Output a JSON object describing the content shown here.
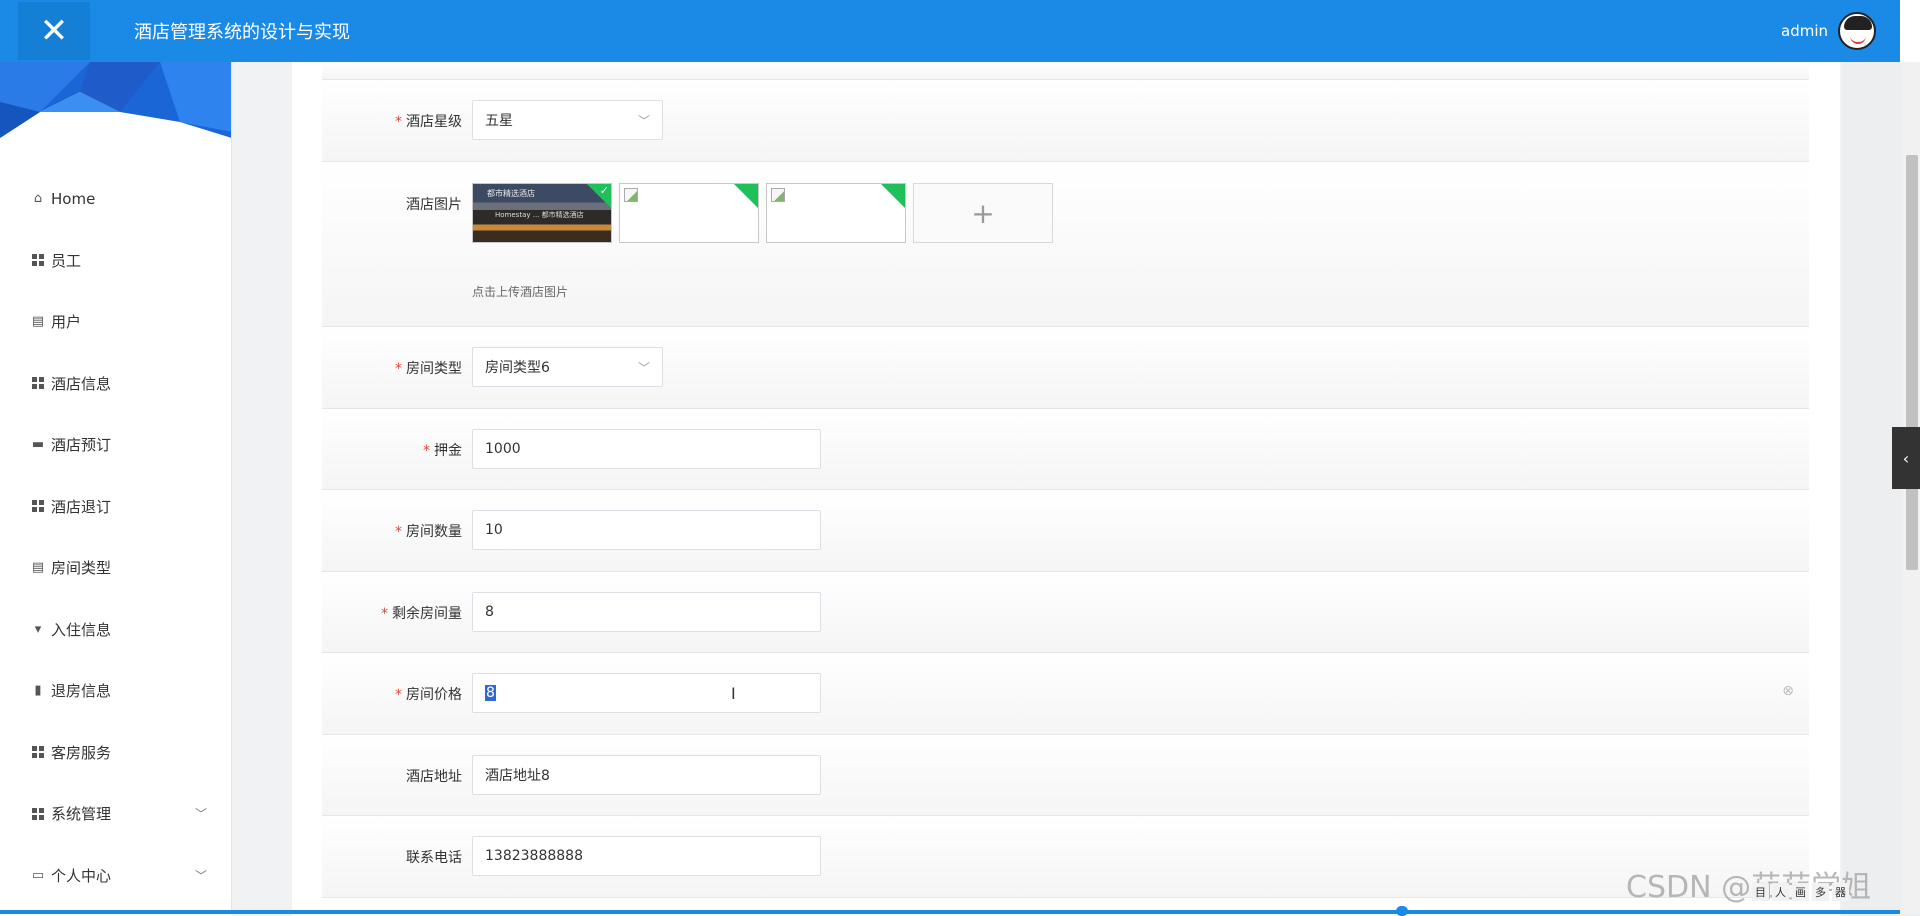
{
  "header": {
    "title": "酒店管理系统的设计与实现",
    "user": "admin",
    "close_glyph": "✕"
  },
  "sidebar": {
    "items": [
      {
        "label": "Home",
        "icon": "home-icon"
      },
      {
        "label": "员工",
        "icon": "grid-icon"
      },
      {
        "label": "用户",
        "icon": "clipboard-icon"
      },
      {
        "label": "酒店信息",
        "icon": "grid-icon"
      },
      {
        "label": "酒店预订",
        "icon": "monitor-icon"
      },
      {
        "label": "酒店退订",
        "icon": "grid-icon"
      },
      {
        "label": "房间类型",
        "icon": "clipboard-icon"
      },
      {
        "label": "入住信息",
        "icon": "flag-icon"
      },
      {
        "label": "退房信息",
        "icon": "bar-chart-icon"
      },
      {
        "label": "客房服务",
        "icon": "grid-icon"
      },
      {
        "label": "系统管理",
        "icon": "grid-icon",
        "expandable": true
      },
      {
        "label": "个人中心",
        "icon": "card-icon",
        "expandable": true
      }
    ]
  },
  "form": {
    "star": {
      "label": "酒店星级",
      "value": "五星",
      "required": true
    },
    "images": {
      "label": "酒店图片",
      "hint": "点击上传酒店图片",
      "upload_glyph": "+",
      "photo_caption_top": "都市精选酒店",
      "photo_caption_bottom": "Homestay ... 都市精选酒店",
      "check_glyph": "✓"
    },
    "room_type": {
      "label": "房间类型",
      "value": "房间类型6",
      "required": true
    },
    "deposit": {
      "label": "押金",
      "value": "1000",
      "required": true
    },
    "room_count": {
      "label": "房间数量",
      "value": "10",
      "required": true
    },
    "remaining": {
      "label": "剩余房间量",
      "value": "8",
      "required": true
    },
    "price": {
      "label": "房间价格",
      "value": "8",
      "required": true
    },
    "address": {
      "label": "酒店地址",
      "value": "酒店地址8",
      "required": false
    },
    "phone": {
      "label": "联系电话",
      "value": "13823888888",
      "required": false
    }
  },
  "watermark": "CSDN @茄茄学姐",
  "tray_items": [
    "目",
    "人",
    "画",
    "多",
    "器"
  ],
  "colors": {
    "primary": "#1a8ae6",
    "required": "#e0453a",
    "upload_badge": "#1fbf5a"
  }
}
